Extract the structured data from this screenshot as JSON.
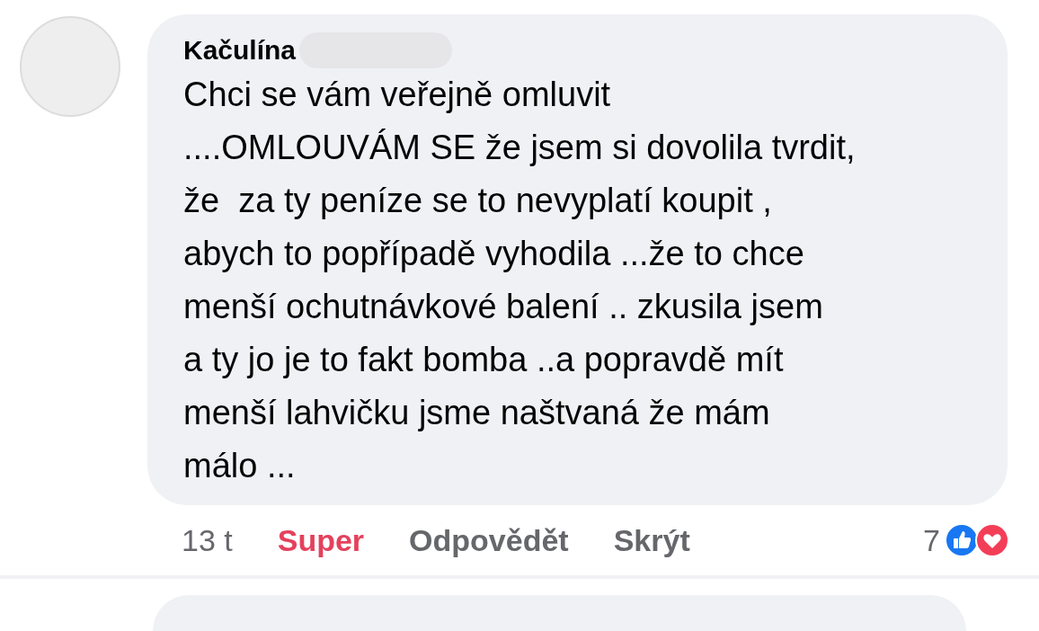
{
  "comment": {
    "author": "Kačulína",
    "author_redacted": true,
    "lines": [
      "Chci se vám veřejně omluvit",
      "....OMLOUVÁM SE že jsem si dovolila tvrdit,",
      "že  za ty peníze se to nevyplatí koupit ,",
      "abych to popřípadě vyhodila ...že to chce",
      "menší ochutnávkové balení .. zkusila jsem",
      "a ty jo je to fakt bomba ..a popravdě mít",
      "menší lahvičku jsme naštvaná že mám",
      "málo ..."
    ],
    "time": "13 t",
    "reaction": {
      "label": "Super",
      "active": true
    },
    "actions": [
      "Odpovědět",
      "Skrýt"
    ],
    "reactions": {
      "count": "7",
      "types": [
        {
          "kind": "like"
        },
        {
          "kind": "love"
        }
      ]
    }
  }
}
